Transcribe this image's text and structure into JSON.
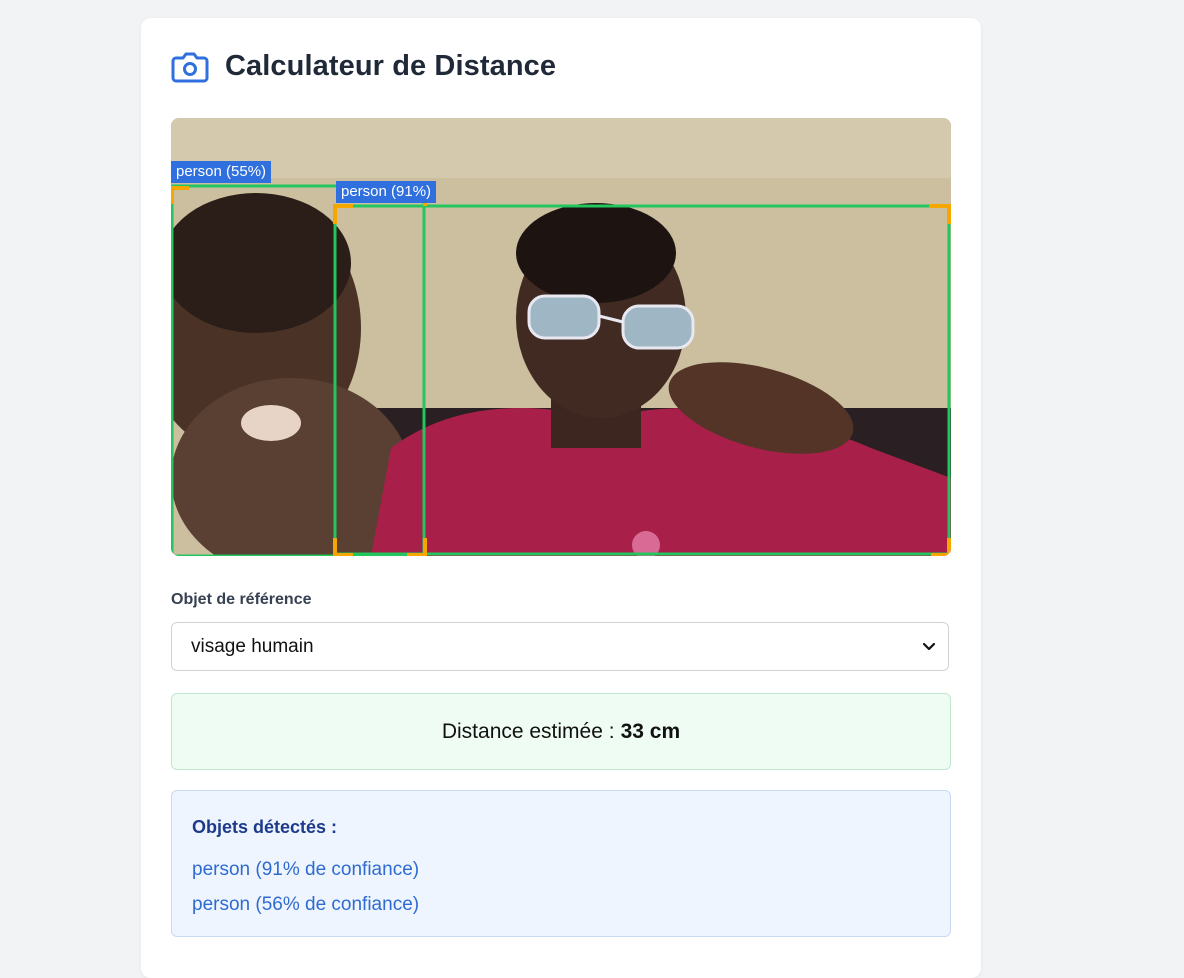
{
  "app": {
    "title": "Calculateur de Distance"
  },
  "camera": {
    "detections": [
      {
        "label": "person (55%)"
      },
      {
        "label": "person (91%)"
      }
    ]
  },
  "reference": {
    "label": "Objet de référence",
    "selected": "visage humain"
  },
  "result": {
    "prefix": "Distance estimée :",
    "value": "33 cm"
  },
  "detected": {
    "heading": "Objets détectés :",
    "items": [
      "person (91% de confiance)",
      "person (56% de confiance)"
    ]
  },
  "colors": {
    "accent": "#2f6fde",
    "box": "#22c55e",
    "corner": "#f5a700"
  }
}
